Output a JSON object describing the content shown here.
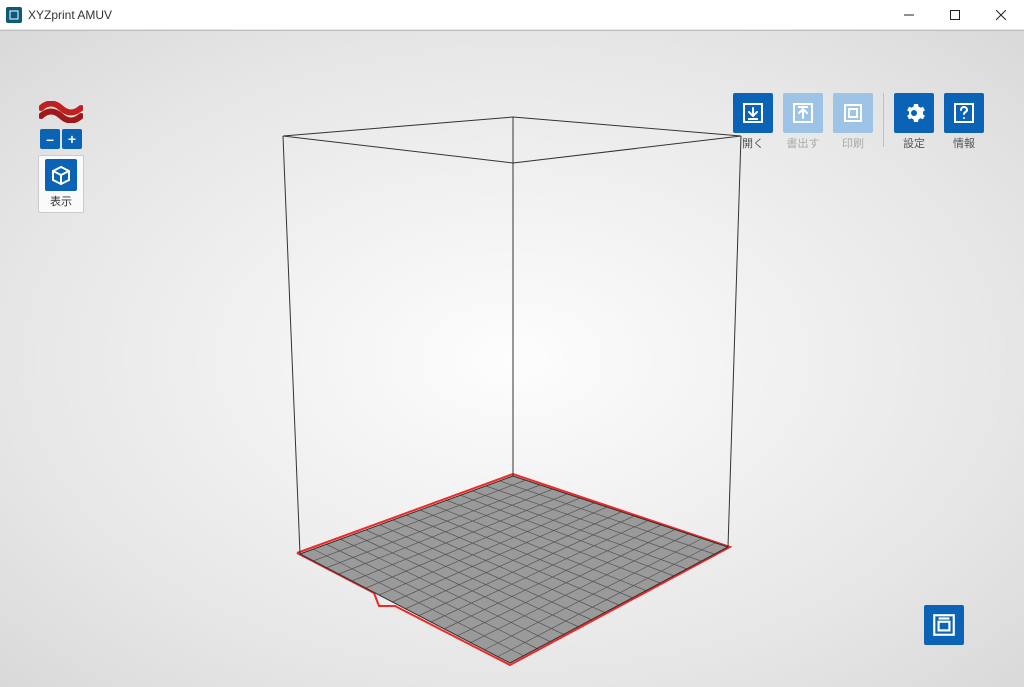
{
  "window": {
    "title": "XYZprint AMUV"
  },
  "leftPanel": {
    "zoomOut": "–",
    "zoomIn": "+",
    "viewLabel": "表示"
  },
  "toolbar": {
    "open": "開く",
    "export": "書出す",
    "print": "印刷",
    "settings": "設定",
    "info": "情報"
  }
}
